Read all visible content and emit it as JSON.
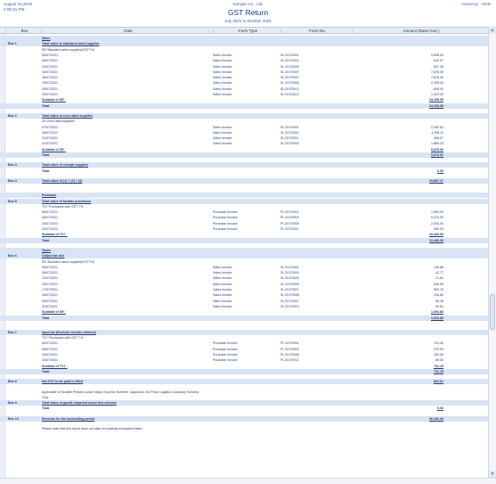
{
  "header": {
    "date": "August 16,2015",
    "time": "2:08:31 PM",
    "company": "Sample Co., Ltd.",
    "currency": "Currency : SGD",
    "title": "GST Return",
    "period": "July 2021 to October 2021"
  },
  "columns": {
    "box": "Box",
    "date": "Date",
    "form_type": "Form Type",
    "form_no": "Form No.",
    "amount": "Amount (Base Curr.)"
  },
  "rows": [
    {
      "k": "band",
      "lbl": "Sales",
      "b": true,
      "u": true
    },
    {
      "k": "band",
      "box": "Box 1",
      "lbl": "Total value at standard-rated supplies",
      "b": true,
      "u": true
    },
    {
      "k": "n",
      "lbl": "SR Standard-rated supplies(GST7%)"
    },
    {
      "k": "n",
      "d": "06/07/2021",
      "ft": "Sales Invoice",
      "fn": "SI-21070001",
      "amt": "2,898.00"
    },
    {
      "k": "n",
      "d": "08/07/2021",
      "ft": "Sales Invoice",
      "fn": "SI-21070004",
      "amt": "610.97"
    },
    {
      "k": "n",
      "d": "12/07/2021",
      "ft": "Sales Invoice",
      "fn": "SI-21070005",
      "amt": "597.36"
    },
    {
      "k": "n",
      "d": "15/07/2021",
      "ft": "Sales Invoice",
      "fn": "SI-21070007",
      "amt": "7,678.50"
    },
    {
      "k": "n",
      "d": "18/07/2021",
      "ft": "Sales Invoice",
      "fn": "SI-21070007",
      "amt": "7,815.00"
    },
    {
      "k": "n",
      "d": "19/07/2021",
      "ft": "Sales Invoice",
      "fn": "SI-21070008",
      "amt": "2,395.00"
    },
    {
      "k": "n",
      "d": "26/07/2021",
      "ft": "Sales Invoice",
      "fn": "SI-21070012",
      "amt": "848.00"
    },
    {
      "k": "n",
      "d": "29/07/2021",
      "ft": "Sales Invoice",
      "fn": "SI-21070013",
      "amt": "1,423.00"
    },
    {
      "k": "n",
      "lbl": "Subtotal of SR :",
      "amt": "24,298.35",
      "b": true,
      "u": true,
      "t": true
    },
    {
      "k": "band",
      "lbl": "Total",
      "amt": "24,298.35",
      "b": true,
      "t": true
    },
    {
      "k": "gap"
    },
    {
      "k": "band",
      "box": "Box 2",
      "lbl": "Total value of zero-rated supplies",
      "b": true,
      "u": true
    },
    {
      "k": "n",
      "lbl": "ZR Zero-rated supplies"
    },
    {
      "k": "n",
      "d": "07/07/2021",
      "ft": "Sales Invoice",
      "fn": "SI-21070001",
      "amt": "2,282.64"
    },
    {
      "k": "n",
      "d": "16/07/2021",
      "ft": "Sales Invoice",
      "fn": "SI-21070010",
      "amt": "1,298.11"
    },
    {
      "k": "n",
      "d": "21/07/2021",
      "ft": "Sales Invoice",
      "fn": "SI-21070011",
      "amt": "468.07"
    },
    {
      "k": "n",
      "d": "31/07/2021",
      "ft": "Sales Invoice",
      "fn": "SI-21070015",
      "amt": "1,889.33"
    },
    {
      "k": "n",
      "lbl": "Subtotal of ZR :",
      "amt": "5,878.92",
      "b": true,
      "u": true,
      "t": true
    },
    {
      "k": "band",
      "lbl": "Total",
      "amt": "5,878.92",
      "b": true,
      "t": true
    },
    {
      "k": "gap"
    },
    {
      "k": "band",
      "box": "Box 3",
      "lbl": "Total value of exempt supplies",
      "b": true,
      "u": true
    },
    {
      "k": "n",
      "lbl": "Total",
      "amt": "0.00",
      "b": true,
      "t": true
    },
    {
      "k": "gap"
    },
    {
      "k": "band",
      "box": "Box 4",
      "lbl": "Total value of (1) + (2) + (3)",
      "b": true,
      "u": true,
      "amt": "29,887.27",
      "t": true
    },
    {
      "k": "gap"
    },
    {
      "k": "gap"
    },
    {
      "k": "band",
      "lbl": "Purchase",
      "b": true,
      "u": true
    },
    {
      "k": "band",
      "box": "Box 5",
      "lbl": "Total value of taxable purchases",
      "b": true,
      "u": true
    },
    {
      "k": "n",
      "lbl": "TX7 Purchases with GST 7%"
    },
    {
      "k": "n",
      "d": "06/07/2021",
      "ft": "Purchase Invoice",
      "fn": "PI-21070001",
      "amt": "1,590.00"
    },
    {
      "k": "n",
      "d": "08/07/2021",
      "ft": "Purchase Invoice",
      "fn": "PI-21070003",
      "amt": "5,370.00"
    },
    {
      "k": "n",
      "d": "26/07/2021",
      "ft": "Purchase Invoice",
      "fn": "PI-21070008",
      "amt": "2,530.00"
    },
    {
      "k": "n",
      "d": "23/07/2021",
      "ft": "Purchase Invoice",
      "fn": "PI-21070011",
      "amt": "950.00"
    },
    {
      "k": "n",
      "lbl": "Subtotal of TX7 :",
      "amt": "10,440.00",
      "b": true,
      "u": true,
      "t": true
    },
    {
      "k": "band",
      "lbl": "Total",
      "amt": "10,440.00",
      "b": true,
      "t": true
    },
    {
      "k": "gap"
    },
    {
      "k": "band",
      "lbl": "Taxes",
      "b": true,
      "u": true
    },
    {
      "k": "band",
      "box": "Box 6",
      "lbl": "Output tax due",
      "b": true,
      "u": true
    },
    {
      "k": "n",
      "lbl": "SR Standard-rated supplies(GST7%)"
    },
    {
      "k": "n",
      "d": "06/07/2021",
      "ft": "Sales Invoice",
      "fn": "SI-21070002",
      "amt": "140.88"
    },
    {
      "k": "n",
      "d": "08/07/2021",
      "ft": "Sales Invoice",
      "fn": "SI-21070004",
      "amt": "42.77"
    },
    {
      "k": "n",
      "d": "12/07/2021",
      "ft": "Sales Invoice",
      "fn": "SI-21070005",
      "amt": "21.82"
    },
    {
      "k": "n",
      "d": "15/07/2021",
      "ft": "Sales Invoice",
      "fn": "SI-21070006",
      "amt": "536.90"
    },
    {
      "k": "n",
      "d": "17/07/2021",
      "ft": "Sales Invoice",
      "fn": "SI-21070007",
      "amt": "563.76"
    },
    {
      "k": "n",
      "d": "18/07/2021",
      "ft": "Sales Invoice",
      "fn": "SI-21070008",
      "amt": "236.80"
    },
    {
      "k": "n",
      "d": "26/07/2021",
      "ft": "Sales Invoice",
      "fn": "SI-21070012",
      "amt": "56.36"
    },
    {
      "k": "n",
      "d": "29/07/2021",
      "ft": "Sales Invoice",
      "fn": "SI-21070013",
      "amt": "99.61"
    },
    {
      "k": "n",
      "lbl": "Subtotal of SR :",
      "amt": "1,694.86",
      "b": true,
      "u": true,
      "t": true
    },
    {
      "k": "band",
      "lbl": "Total",
      "amt": "1,694.86",
      "b": true,
      "t": true
    },
    {
      "k": "gap"
    },
    {
      "k": "gap"
    },
    {
      "k": "band",
      "box": "Box 7",
      "lbl": "Input tax (Exclude refunds claimed)",
      "b": true,
      "u": true
    },
    {
      "k": "n",
      "lbl": "TX7 Purchases with GST 7%"
    },
    {
      "k": "n",
      "d": "06/07/2021",
      "ft": "Purchase Invoice",
      "fn": "PI-21070001",
      "amt": "111.30"
    },
    {
      "k": "n",
      "d": "08/07/2021",
      "ft": "Purchase Invoice",
      "fn": "PI-21070003",
      "amt": "375.90"
    },
    {
      "k": "n",
      "d": "26/07/2021",
      "ft": "Purchase Invoice",
      "fn": "PI-21070008",
      "amt": "184.49"
    },
    {
      "k": "n",
      "d": "23/07/2021",
      "ft": "Purchase Invoice",
      "fn": "PI-21070011",
      "amt": "69.50"
    },
    {
      "k": "n",
      "lbl": "Subtotal of TX7 :",
      "amt": "731.15",
      "b": true,
      "u": true,
      "t": true
    },
    {
      "k": "band",
      "lbl": "Total",
      "amt": "731.15",
      "b": true,
      "t": true
    },
    {
      "k": "gap"
    },
    {
      "k": "band",
      "box": "Box 8",
      "lbl": "Net GST to be paid to IRAS",
      "b": true,
      "u": true,
      "amt": "963.61",
      "t": true
    },
    {
      "k": "gap"
    },
    {
      "k": "n",
      "lbl": "Applicable to Taxable Persons under Major Exporter Scheme / Approved 3rd Party Logistics Company Scheme"
    },
    {
      "k": "n",
      "lbl": "Only"
    },
    {
      "k": "band",
      "box": "Box 9",
      "lbl": "Total value of goods imported under this scheme",
      "b": true,
      "u": true
    },
    {
      "k": "n",
      "lbl": "Total",
      "amt": "0.00",
      "b": true,
      "t": true
    },
    {
      "k": "gap"
    },
    {
      "k": "band",
      "box": "Box 13",
      "lbl": "Revenue for the accounting period",
      "b": true,
      "u": true,
      "amt": "36,182.94",
      "t": true
    },
    {
      "k": "gap"
    },
    {
      "k": "n",
      "lbl": "Please note that this report does not cater for partially exempted trader."
    }
  ]
}
